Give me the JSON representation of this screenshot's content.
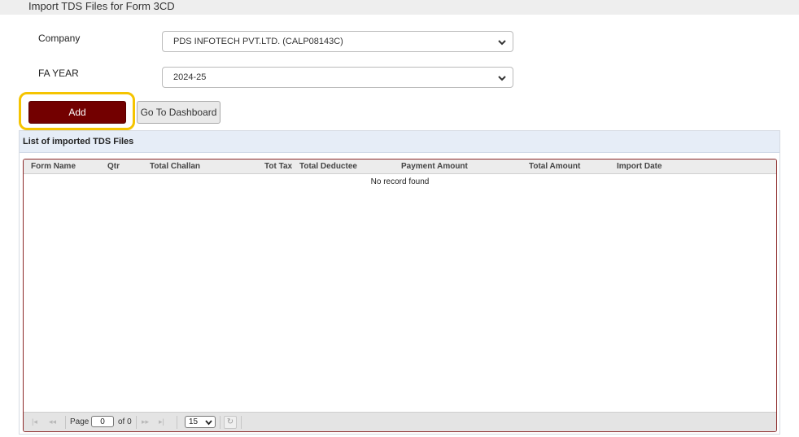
{
  "header": {
    "title": "Import TDS Files for Form 3CD"
  },
  "form": {
    "company_label": "Company",
    "company_value": "PDS INFOTECH PVT.LTD. (CALP08143C)",
    "fa_year_label": "FA YEAR",
    "fa_year_value": "2024-25"
  },
  "buttons": {
    "add": "Add",
    "dashboard": "Go To Dashboard"
  },
  "colors": {
    "add_button": "#730000",
    "highlight": "#f5c400"
  },
  "panel": {
    "title": "List of imported TDS Files",
    "columns": [
      "Form Name",
      "Qtr",
      "Total Challan",
      "Tot Tax",
      "Total Deductee",
      "Payment Amount",
      "Total Amount",
      "Import Date"
    ],
    "empty_message": "No record found"
  },
  "pager": {
    "page_label": "Page",
    "page_value": "0",
    "of_label": "of 0",
    "page_size": "15",
    "icons": [
      "first-page-icon",
      "prev-page-icon",
      "next-page-icon",
      "last-page-icon",
      "refresh-icon"
    ]
  }
}
